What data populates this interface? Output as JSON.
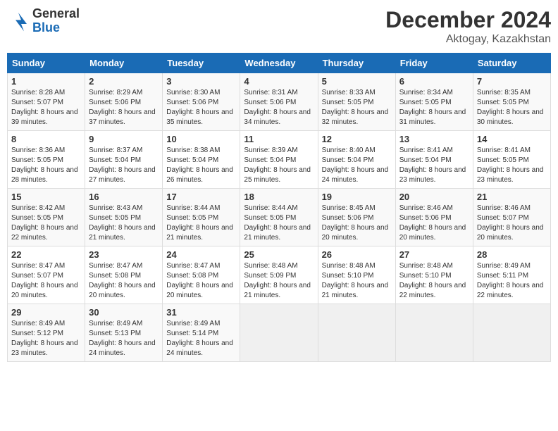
{
  "header": {
    "logo_line1": "General",
    "logo_line2": "Blue",
    "title": "December 2024",
    "subtitle": "Aktogay, Kazakhstan"
  },
  "weekdays": [
    "Sunday",
    "Monday",
    "Tuesday",
    "Wednesday",
    "Thursday",
    "Friday",
    "Saturday"
  ],
  "weeks": [
    [
      {
        "day": "1",
        "sunrise": "8:28 AM",
        "sunset": "5:07 PM",
        "daylight": "8 hours and 39 minutes."
      },
      {
        "day": "2",
        "sunrise": "8:29 AM",
        "sunset": "5:06 PM",
        "daylight": "8 hours and 37 minutes."
      },
      {
        "day": "3",
        "sunrise": "8:30 AM",
        "sunset": "5:06 PM",
        "daylight": "8 hours and 35 minutes."
      },
      {
        "day": "4",
        "sunrise": "8:31 AM",
        "sunset": "5:06 PM",
        "daylight": "8 hours and 34 minutes."
      },
      {
        "day": "5",
        "sunrise": "8:33 AM",
        "sunset": "5:05 PM",
        "daylight": "8 hours and 32 minutes."
      },
      {
        "day": "6",
        "sunrise": "8:34 AM",
        "sunset": "5:05 PM",
        "daylight": "8 hours and 31 minutes."
      },
      {
        "day": "7",
        "sunrise": "8:35 AM",
        "sunset": "5:05 PM",
        "daylight": "8 hours and 30 minutes."
      }
    ],
    [
      {
        "day": "8",
        "sunrise": "8:36 AM",
        "sunset": "5:05 PM",
        "daylight": "8 hours and 28 minutes."
      },
      {
        "day": "9",
        "sunrise": "8:37 AM",
        "sunset": "5:04 PM",
        "daylight": "8 hours and 27 minutes."
      },
      {
        "day": "10",
        "sunrise": "8:38 AM",
        "sunset": "5:04 PM",
        "daylight": "8 hours and 26 minutes."
      },
      {
        "day": "11",
        "sunrise": "8:39 AM",
        "sunset": "5:04 PM",
        "daylight": "8 hours and 25 minutes."
      },
      {
        "day": "12",
        "sunrise": "8:40 AM",
        "sunset": "5:04 PM",
        "daylight": "8 hours and 24 minutes."
      },
      {
        "day": "13",
        "sunrise": "8:41 AM",
        "sunset": "5:04 PM",
        "daylight": "8 hours and 23 minutes."
      },
      {
        "day": "14",
        "sunrise": "8:41 AM",
        "sunset": "5:05 PM",
        "daylight": "8 hours and 23 minutes."
      }
    ],
    [
      {
        "day": "15",
        "sunrise": "8:42 AM",
        "sunset": "5:05 PM",
        "daylight": "8 hours and 22 minutes."
      },
      {
        "day": "16",
        "sunrise": "8:43 AM",
        "sunset": "5:05 PM",
        "daylight": "8 hours and 21 minutes."
      },
      {
        "day": "17",
        "sunrise": "8:44 AM",
        "sunset": "5:05 PM",
        "daylight": "8 hours and 21 minutes."
      },
      {
        "day": "18",
        "sunrise": "8:44 AM",
        "sunset": "5:05 PM",
        "daylight": "8 hours and 21 minutes."
      },
      {
        "day": "19",
        "sunrise": "8:45 AM",
        "sunset": "5:06 PM",
        "daylight": "8 hours and 20 minutes."
      },
      {
        "day": "20",
        "sunrise": "8:46 AM",
        "sunset": "5:06 PM",
        "daylight": "8 hours and 20 minutes."
      },
      {
        "day": "21",
        "sunrise": "8:46 AM",
        "sunset": "5:07 PM",
        "daylight": "8 hours and 20 minutes."
      }
    ],
    [
      {
        "day": "22",
        "sunrise": "8:47 AM",
        "sunset": "5:07 PM",
        "daylight": "8 hours and 20 minutes."
      },
      {
        "day": "23",
        "sunrise": "8:47 AM",
        "sunset": "5:08 PM",
        "daylight": "8 hours and 20 minutes."
      },
      {
        "day": "24",
        "sunrise": "8:47 AM",
        "sunset": "5:08 PM",
        "daylight": "8 hours and 20 minutes."
      },
      {
        "day": "25",
        "sunrise": "8:48 AM",
        "sunset": "5:09 PM",
        "daylight": "8 hours and 21 minutes."
      },
      {
        "day": "26",
        "sunrise": "8:48 AM",
        "sunset": "5:10 PM",
        "daylight": "8 hours and 21 minutes."
      },
      {
        "day": "27",
        "sunrise": "8:48 AM",
        "sunset": "5:10 PM",
        "daylight": "8 hours and 22 minutes."
      },
      {
        "day": "28",
        "sunrise": "8:49 AM",
        "sunset": "5:11 PM",
        "daylight": "8 hours and 22 minutes."
      }
    ],
    [
      {
        "day": "29",
        "sunrise": "8:49 AM",
        "sunset": "5:12 PM",
        "daylight": "8 hours and 23 minutes."
      },
      {
        "day": "30",
        "sunrise": "8:49 AM",
        "sunset": "5:13 PM",
        "daylight": "8 hours and 24 minutes."
      },
      {
        "day": "31",
        "sunrise": "8:49 AM",
        "sunset": "5:14 PM",
        "daylight": "8 hours and 24 minutes."
      },
      null,
      null,
      null,
      null
    ]
  ]
}
